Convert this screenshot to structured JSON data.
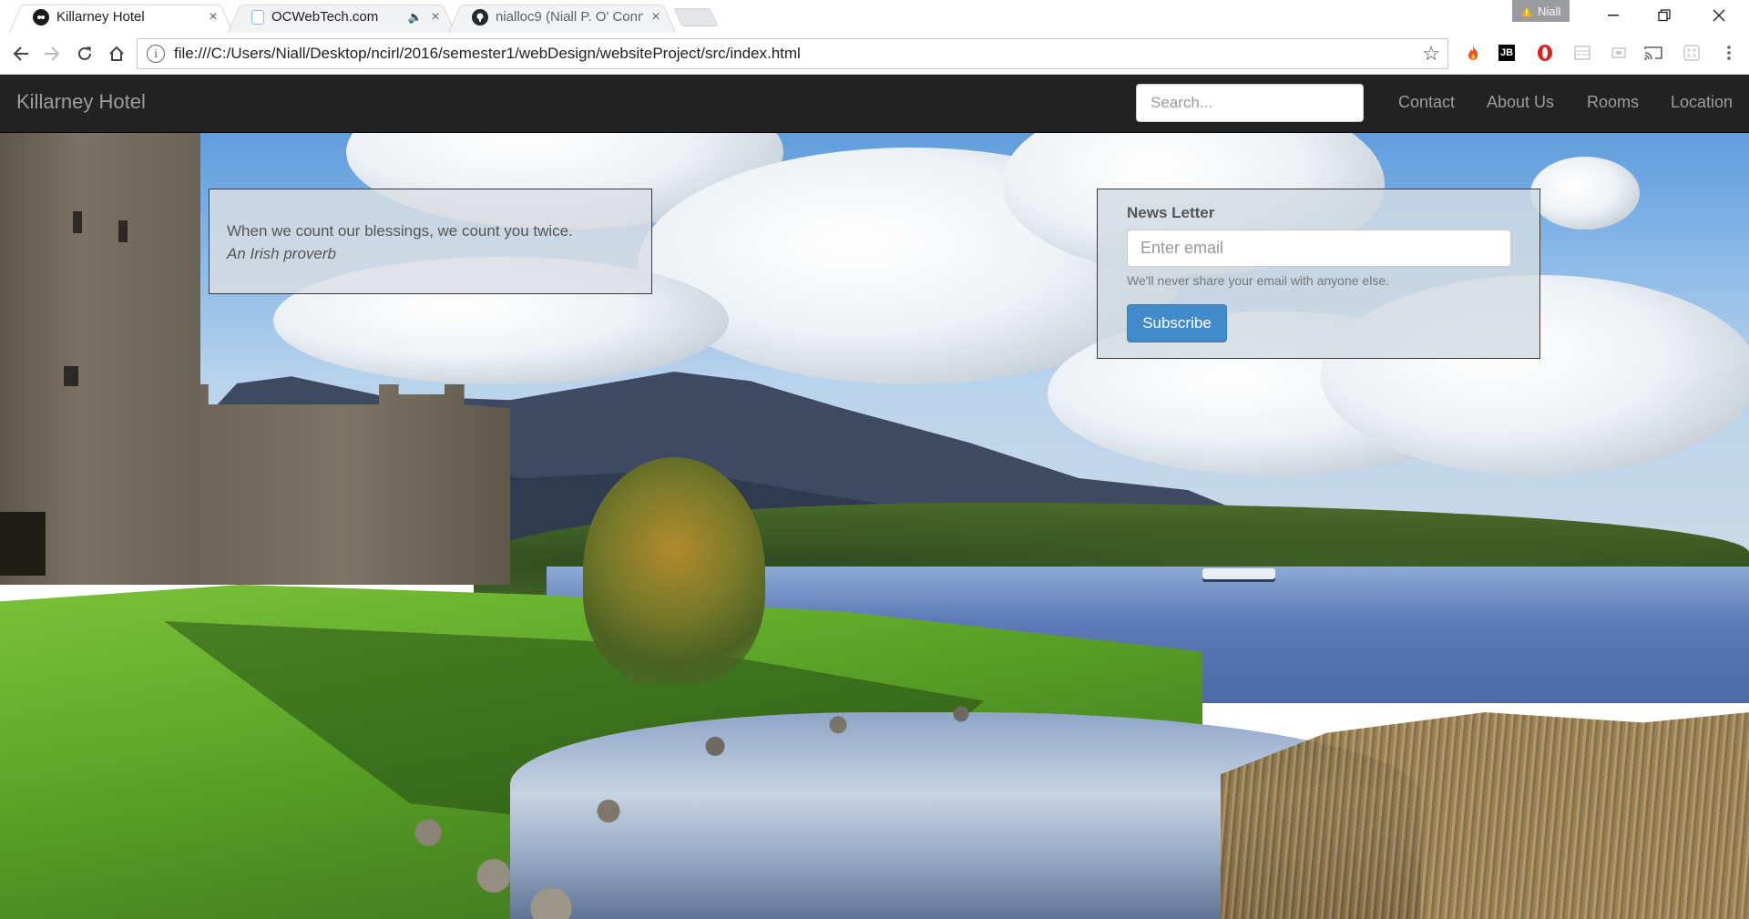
{
  "browser": {
    "tabs": [
      {
        "title": "Killarney Hotel",
        "close": "×",
        "active": true
      },
      {
        "title": "OCWebTech.com",
        "close": "×",
        "active": false,
        "audio_icon": "speaker-icon"
      },
      {
        "title": "nialloc9 (Niall P. O' Conn",
        "close": "×",
        "active": false
      }
    ],
    "profile_name": "Niall",
    "url": "file:///C:/Users/Niall/Desktop/ncirl/2016/semester1/webDesign/websiteProject/src/index.html",
    "window_controls": [
      "minimize-icon",
      "restore-icon",
      "close-icon"
    ],
    "extensions": [
      "fire-icon",
      "jb-icon",
      "opera-icon",
      "table-icon",
      "page-icon",
      "cast-icon",
      "grid-icon",
      "menu-icon"
    ]
  },
  "site": {
    "brand": "Killarney Hotel",
    "search_placeholder": "Search...",
    "nav": [
      "Contact",
      "About Us",
      "Rooms",
      "Location"
    ]
  },
  "quote": {
    "text": "When we count our blessings, we count you twice.",
    "source": "An Irish proverb"
  },
  "newsletter": {
    "title": "News Letter",
    "email_placeholder": "Enter email",
    "help": "We'll never share your email with anyone else.",
    "button": "Subscribe"
  },
  "colors": {
    "navbar_bg": "#222222",
    "nav_text": "#9d9d9d",
    "button_primary": "#428bca"
  }
}
